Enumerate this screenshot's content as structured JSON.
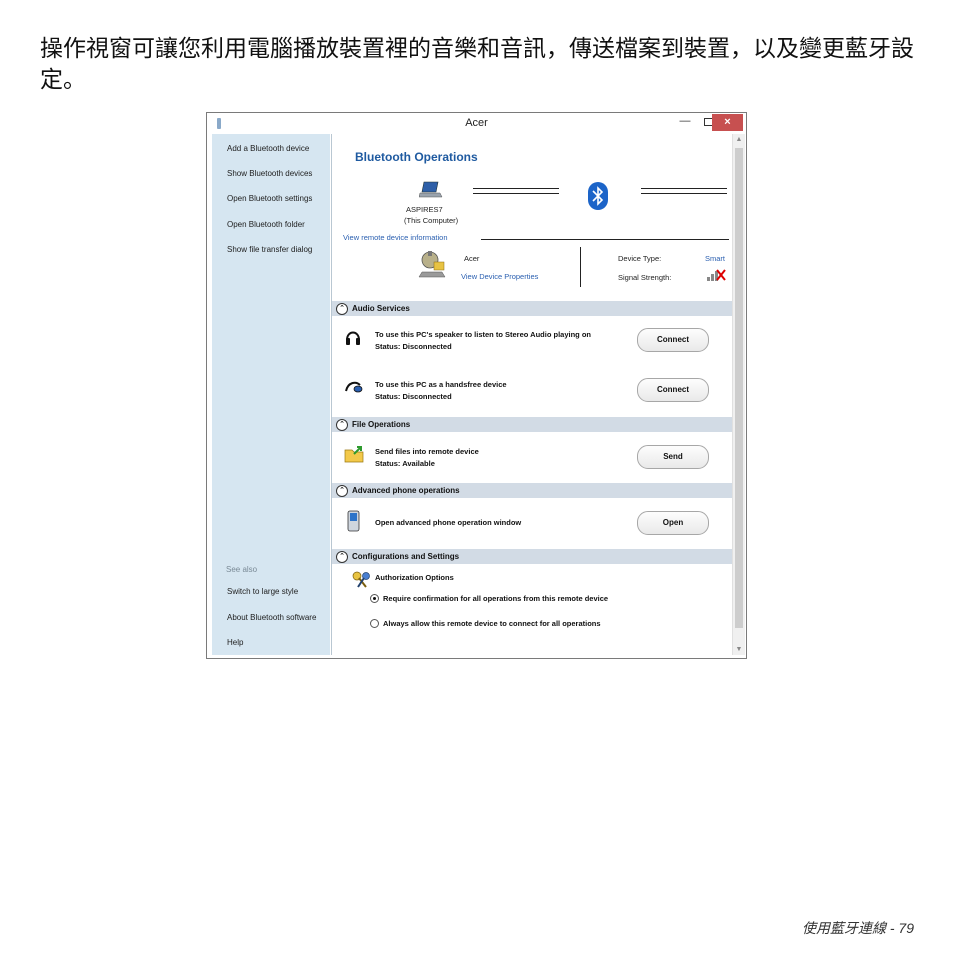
{
  "intro_text": "操作視窗可讓您利用電腦播放裝置裡的音樂和音訊，傳送檔案到裝置，以及變更藍牙設定。",
  "footer": {
    "section": "使用藍牙連線 -",
    "page": "79"
  },
  "window": {
    "title": "Acer",
    "controls": {
      "minimize": "—",
      "close": "×"
    }
  },
  "sidebar": {
    "items": [
      "Add a Bluetooth device",
      "Show Bluetooth devices",
      "Open Bluetooth settings",
      "Open Bluetooth folder",
      "Show file transfer dialog"
    ],
    "see_also": "See also",
    "bottom_items": [
      "Switch to large style",
      "About Bluetooth software",
      "Help"
    ]
  },
  "operations": {
    "title": "Bluetooth Operations",
    "computer_name": "ASPIRES7",
    "computer_note": "(This Computer)",
    "remote_info_link": "View remote device information",
    "device_name": "Acer",
    "device_properties_link": "View Device Properties",
    "device_type_label": "Device Type:",
    "device_type_value": "Smart",
    "signal_label": "Signal Strength:"
  },
  "sections": {
    "audio": {
      "title": "Audio Services",
      "rows": [
        {
          "text": "To use this PC's speaker to listen to Stereo Audio playing on",
          "status": "Status:   Disconnected",
          "button": "Connect",
          "icon": "headphones-icon"
        },
        {
          "text": "To use this PC as a handsfree device",
          "status": "Status:   Disconnected",
          "button": "Connect",
          "icon": "headset-icon"
        }
      ]
    },
    "file": {
      "title": "File Operations",
      "row": {
        "text": "Send files into remote device",
        "status": "Status:   Available",
        "button": "Send",
        "icon": "folder-send-icon"
      }
    },
    "phone": {
      "title": "Advanced phone operations",
      "row": {
        "text": "Open advanced phone operation window",
        "button": "Open",
        "icon": "phone-icon"
      }
    },
    "config": {
      "title": "Configurations and Settings",
      "auth_title": "Authorization Options",
      "option1": "Require confirmation for all operations from this remote device",
      "option2": "Always allow this remote device to connect for all operations",
      "selected": "option1"
    }
  },
  "colors": {
    "accent": "#1f5aa0",
    "sidebar_bg": "#d6e6f1",
    "section_bg": "#d2dbe5",
    "close_button": "#c75050",
    "bluetooth": "#1c64c8"
  }
}
